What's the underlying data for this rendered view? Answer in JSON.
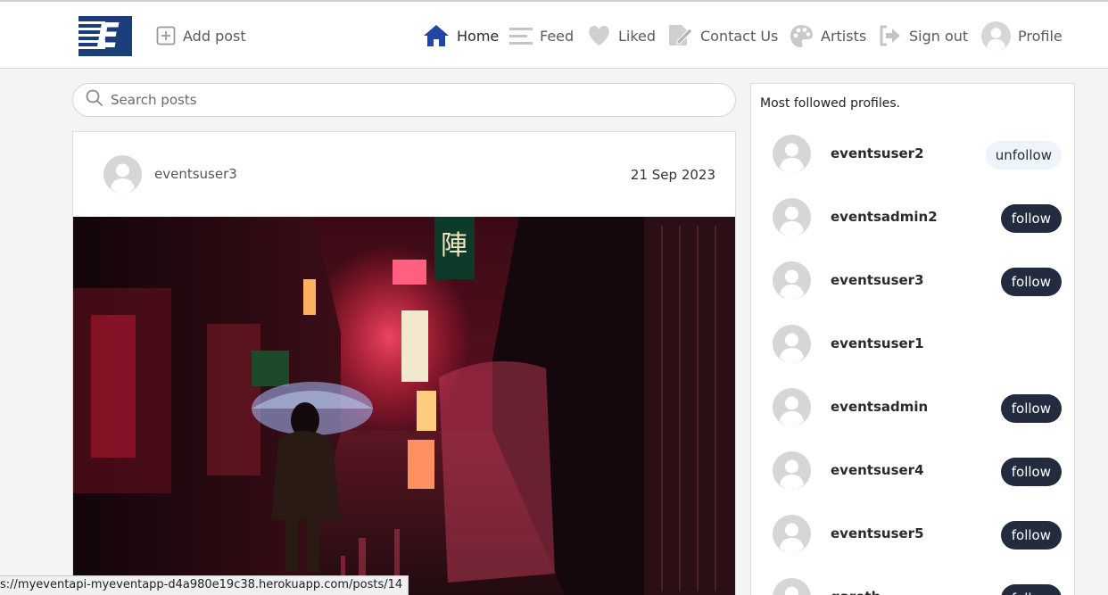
{
  "nav": {
    "add_post": "Add post",
    "home": "Home",
    "feed": "Feed",
    "liked": "Liked",
    "contact": "Contact Us",
    "artists": "Artists",
    "sign_out": "Sign out",
    "profile": "Profile"
  },
  "search": {
    "placeholder": "Search posts"
  },
  "post": {
    "username": "eventsuser3",
    "date": "21 Sep 2023"
  },
  "sidebar": {
    "title": "Most followed profiles.",
    "profiles": [
      {
        "name": "eventsuser2",
        "action": "unfollow"
      },
      {
        "name": "eventsadmin2",
        "action": "follow"
      },
      {
        "name": "eventsuser3",
        "action": "follow"
      },
      {
        "name": "eventsuser1",
        "action": ""
      },
      {
        "name": "eventsadmin",
        "action": "follow"
      },
      {
        "name": "eventsuser4",
        "action": "follow"
      },
      {
        "name": "eventsuser5",
        "action": "follow"
      },
      {
        "name": "gareth",
        "action": "follow"
      }
    ]
  },
  "status_url": "s://myeventapi-myeventapp-d4a980e19c38.herokuapp.com/posts/14",
  "colors": {
    "brand": "#1b3d7a",
    "follow_button": "#232b3f",
    "home_icon": "#2144a5"
  }
}
